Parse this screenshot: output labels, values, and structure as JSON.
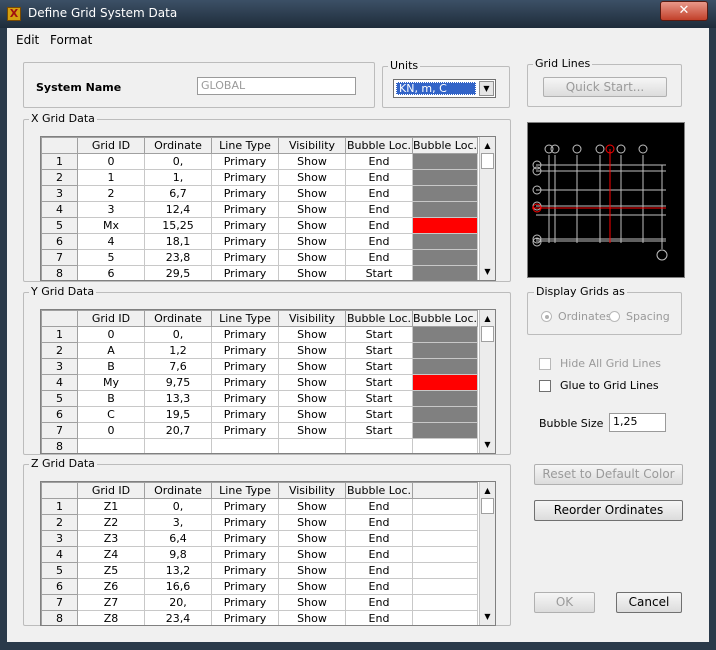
{
  "window": {
    "title": "Define Grid System Data",
    "close_glyph": "✕",
    "icon_glyph": "X"
  },
  "menu": {
    "edit": "Edit",
    "format": "Format"
  },
  "system_name": {
    "label": "System Name",
    "value": "GLOBAL"
  },
  "units": {
    "legend": "Units",
    "value": "KN, m, C"
  },
  "grid_lines": {
    "legend": "Grid Lines",
    "quick_start": "Quick Start..."
  },
  "columns_xy": [
    "Grid ID",
    "Ordinate",
    "Line Type",
    "Visibility",
    "Bubble Loc.",
    "Bubble Loc."
  ],
  "columns_z": [
    "Grid ID",
    "Ordinate",
    "Line Type",
    "Visibility",
    "Bubble Loc."
  ],
  "x_grid": {
    "legend": "X Grid Data",
    "rows": [
      {
        "n": "1",
        "id": "0",
        "ord": "0,",
        "type": "Primary",
        "vis": "Show",
        "bub": "End",
        "color": "#808080"
      },
      {
        "n": "2",
        "id": "1",
        "ord": "1,",
        "type": "Primary",
        "vis": "Show",
        "bub": "End",
        "color": "#808080"
      },
      {
        "n": "3",
        "id": "2",
        "ord": "6,7",
        "type": "Primary",
        "vis": "Show",
        "bub": "End",
        "color": "#808080"
      },
      {
        "n": "4",
        "id": "3",
        "ord": "12,4",
        "type": "Primary",
        "vis": "Show",
        "bub": "End",
        "color": "#808080"
      },
      {
        "n": "5",
        "id": "Mx",
        "ord": "15,25",
        "type": "Primary",
        "vis": "Show",
        "bub": "End",
        "color": "#ff0000"
      },
      {
        "n": "6",
        "id": "4",
        "ord": "18,1",
        "type": "Primary",
        "vis": "Show",
        "bub": "End",
        "color": "#808080"
      },
      {
        "n": "7",
        "id": "5",
        "ord": "23,8",
        "type": "Primary",
        "vis": "Show",
        "bub": "End",
        "color": "#808080"
      },
      {
        "n": "8",
        "id": "6",
        "ord": "29,5",
        "type": "Primary",
        "vis": "Show",
        "bub": "Start",
        "color": "#808080"
      }
    ]
  },
  "y_grid": {
    "legend": "Y Grid Data",
    "rows": [
      {
        "n": "1",
        "id": "0",
        "ord": "0,",
        "type": "Primary",
        "vis": "Show",
        "bub": "Start",
        "color": "#808080"
      },
      {
        "n": "2",
        "id": "A",
        "ord": "1,2",
        "type": "Primary",
        "vis": "Show",
        "bub": "Start",
        "color": "#808080"
      },
      {
        "n": "3",
        "id": "B",
        "ord": "7,6",
        "type": "Primary",
        "vis": "Show",
        "bub": "Start",
        "color": "#808080"
      },
      {
        "n": "4",
        "id": "My",
        "ord": "9,75",
        "type": "Primary",
        "vis": "Show",
        "bub": "Start",
        "color": "#ff0000"
      },
      {
        "n": "5",
        "id": "B",
        "ord": "13,3",
        "type": "Primary",
        "vis": "Show",
        "bub": "Start",
        "color": "#808080"
      },
      {
        "n": "6",
        "id": "C",
        "ord": "19,5",
        "type": "Primary",
        "vis": "Show",
        "bub": "Start",
        "color": "#808080"
      },
      {
        "n": "7",
        "id": "0",
        "ord": "20,7",
        "type": "Primary",
        "vis": "Show",
        "bub": "Start",
        "color": "#808080"
      },
      {
        "n": "8",
        "id": "",
        "ord": "",
        "type": "",
        "vis": "",
        "bub": "",
        "color": "#ffffff"
      }
    ]
  },
  "z_grid": {
    "legend": "Z Grid Data",
    "rows": [
      {
        "n": "1",
        "id": "Z1",
        "ord": "0,",
        "type": "Primary",
        "vis": "Show",
        "bub": "End"
      },
      {
        "n": "2",
        "id": "Z2",
        "ord": "3,",
        "type": "Primary",
        "vis": "Show",
        "bub": "End"
      },
      {
        "n": "3",
        "id": "Z3",
        "ord": "6,4",
        "type": "Primary",
        "vis": "Show",
        "bub": "End"
      },
      {
        "n": "4",
        "id": "Z4",
        "ord": "9,8",
        "type": "Primary",
        "vis": "Show",
        "bub": "End"
      },
      {
        "n": "5",
        "id": "Z5",
        "ord": "13,2",
        "type": "Primary",
        "vis": "Show",
        "bub": "End"
      },
      {
        "n": "6",
        "id": "Z6",
        "ord": "16,6",
        "type": "Primary",
        "vis": "Show",
        "bub": "End"
      },
      {
        "n": "7",
        "id": "Z7",
        "ord": "20,",
        "type": "Primary",
        "vis": "Show",
        "bub": "End"
      },
      {
        "n": "8",
        "id": "Z8",
        "ord": "23,4",
        "type": "Primary",
        "vis": "Show",
        "bub": "End"
      }
    ]
  },
  "display_grids": {
    "legend": "Display Grids as",
    "ordinates": "Ordinates",
    "spacing": "Spacing"
  },
  "hide_all": "Hide All Grid Lines",
  "glue": "Glue to Grid Lines",
  "bubble_size": {
    "label": "Bubble Size",
    "value": "1,25"
  },
  "buttons": {
    "reset": "Reset to Default Color",
    "reorder": "Reorder Ordinates",
    "ok": "OK",
    "cancel": "Cancel"
  }
}
